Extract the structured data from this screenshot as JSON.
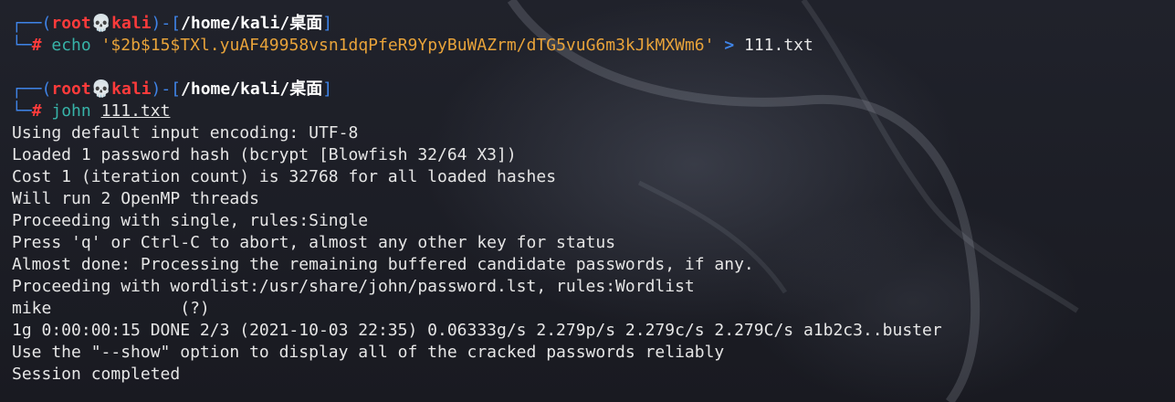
{
  "prompt": {
    "user": "root",
    "skull": "💀",
    "host": "kali",
    "cwd": "/home/kali/桌面",
    "hash_symbol": "#",
    "frame_top_left": "┌──(",
    "frame_mid": ")-[",
    "frame_end": "]",
    "frame_bottom": "└─"
  },
  "commands": [
    {
      "name": "echo",
      "string_arg": "'$2b$15$TXl.yuAF49958vsn1dqPfeR9YpyBuWAZrm/dTG5vuG6m3kJkMXWm6'",
      "redirect": ">",
      "target": "111.txt"
    },
    {
      "name": "john",
      "file_arg": "111.txt"
    }
  ],
  "output": [
    "Using default input encoding: UTF-8",
    "Loaded 1 password hash (bcrypt [Blowfish 32/64 X3])",
    "Cost 1 (iteration count) is 32768 for all loaded hashes",
    "Will run 2 OpenMP threads",
    "Proceeding with single, rules:Single",
    "Press 'q' or Ctrl-C to abort, almost any other key for status",
    "Almost done: Processing the remaining buffered candidate passwords, if any.",
    "Proceeding with wordlist:/usr/share/john/password.lst, rules:Wordlist",
    "mike             (?)",
    "1g 0:00:00:15 DONE 2/3 (2021-10-03 22:35) 0.06333g/s 2.279p/s 2.279c/s 2.279C/s a1b2c3..buster",
    "Use the \"--show\" option to display all of the cracked passwords reliably",
    "Session completed"
  ]
}
